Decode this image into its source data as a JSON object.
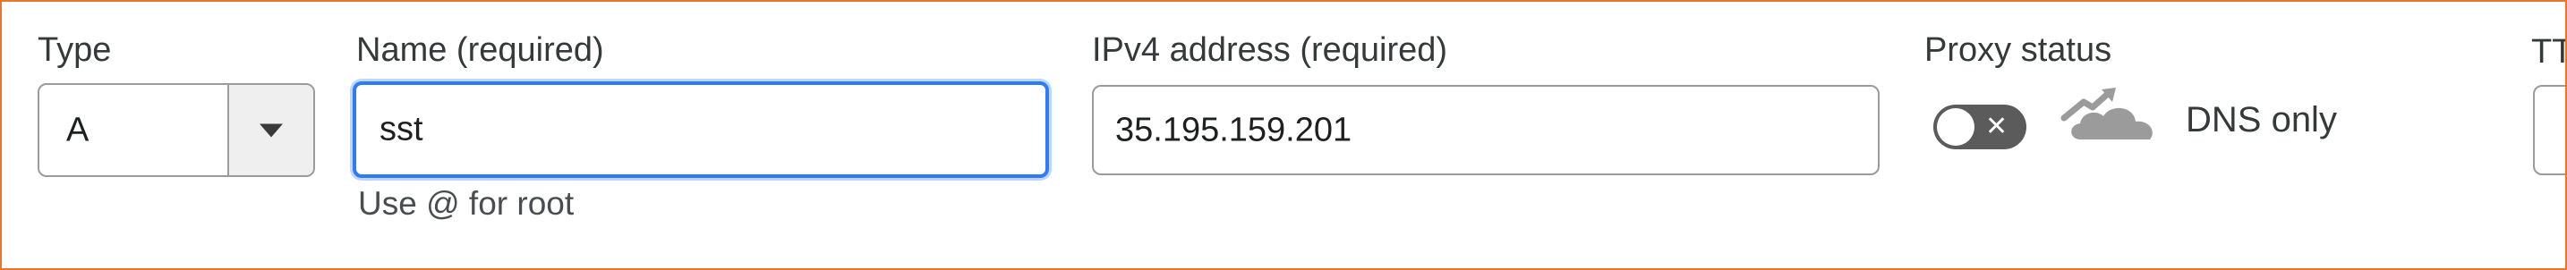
{
  "type": {
    "label": "Type",
    "value": "A"
  },
  "name": {
    "label": "Name (required)",
    "value": "sst",
    "hint": "Use @ for root"
  },
  "ipv4": {
    "label": "IPv4 address (required)",
    "value": "35.195.159.201"
  },
  "proxy": {
    "label": "Proxy status",
    "enabled": false,
    "toggle_off_glyph": "✕",
    "icon": "cloud-icon",
    "status_text": "DNS only"
  },
  "ttl": {
    "label": "TT"
  },
  "colors": {
    "frame_border": "#e8762d",
    "focus_blue": "#2f7bf6",
    "toggle_off": "#5b5b5b",
    "cloud_gray": "#9b9b9b"
  }
}
